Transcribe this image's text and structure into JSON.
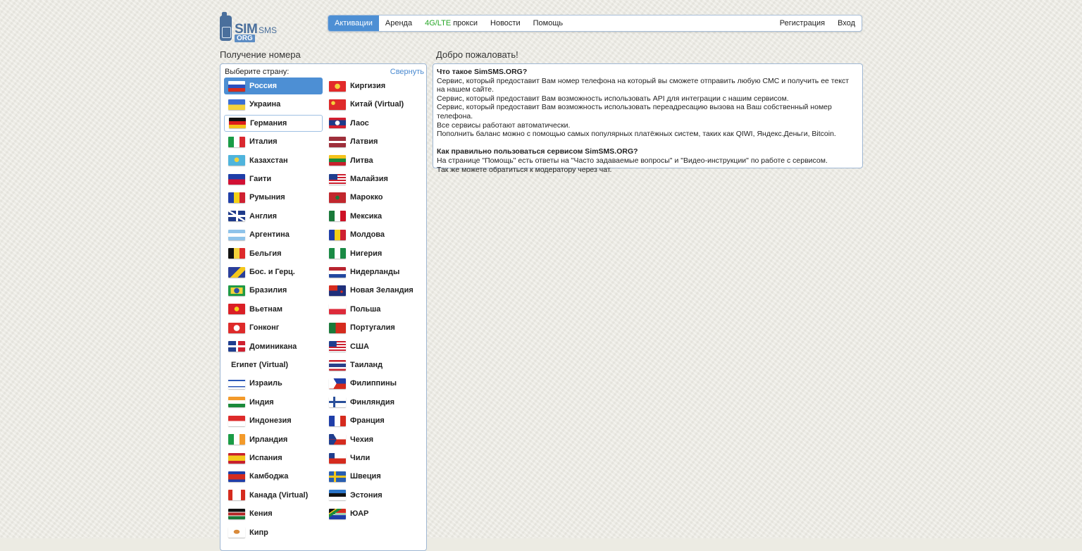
{
  "logo": {
    "sim": "SIM",
    "sms": "SMS",
    "org": "ORG"
  },
  "nav": {
    "items": [
      "Активации",
      "Аренда"
    ],
    "proxy_green": "4G/LTE",
    "proxy_label": " прокси",
    "news": "Новости",
    "help": "Помощь",
    "register": "Регистрация",
    "login": "Вход"
  },
  "left_title": "Получение номера",
  "right_title": "Добро пожаловать!",
  "countries_panel": {
    "label": "Выберите страну:",
    "collapse": "Свернуть",
    "col1": [
      "Россия",
      "Украина",
      "Германия",
      "Италия",
      "Казахстан",
      "Гаити",
      "Румыния",
      "Англия",
      "Аргентина",
      "Бельгия",
      "Бос. и Герц.",
      "Бразилия",
      "Вьетнам",
      "Гонконг",
      "Доминикана",
      "Египет (Virtual)",
      "Израиль",
      "Индия",
      "Индонезия",
      "Ирландия",
      "Испания",
      "Камбоджа",
      "Канада (Virtual)",
      "Кения",
      "Кипр"
    ],
    "col2": [
      "Киргизия",
      "Китай (Virtual)",
      "Лаос",
      "Латвия",
      "Литва",
      "Малайзия",
      "Марокко",
      "Мексика",
      "Молдова",
      "Нигерия",
      "Нидерланды",
      "Новая Зеландия",
      "Польша",
      "Португалия",
      "США",
      "Таиланд",
      "Филиппины",
      "Финляндия",
      "Франция",
      "Чехия",
      "Чили",
      "Швеция",
      "Эстония",
      "ЮАР"
    ]
  },
  "welcome": {
    "q1": "Что такое SimSMS.ORG?",
    "lines1": [
      "Сервис, который предоставит Вам номер телефона на который вы сможете отправить любую СМС и получить ее текст на нашем сайте.",
      "Сервис, который предоставит Вам возможность использовать API для интеграции с нашим сервисом.",
      "Сервис, который предоставит Вам возможность использовать переадресацию вызова на Ваш собственный номер телефона.",
      "Все сервисы работают автоматически.",
      "Пополнить баланс можно с помощью самых популярных платёжных систем, таких как QIWI, Яндекс.Деньги, Bitcoin."
    ],
    "q2": "Как правильно пользоваться сервисом SimSMS.ORG?",
    "lines2": [
      "На странице \"Помощь\" есть ответы на \"Часто задаваемые вопросы\" и \"Видео-инструкции\" по работе с сервисом.",
      "Так же можете обратиться к модератору через чат."
    ]
  }
}
